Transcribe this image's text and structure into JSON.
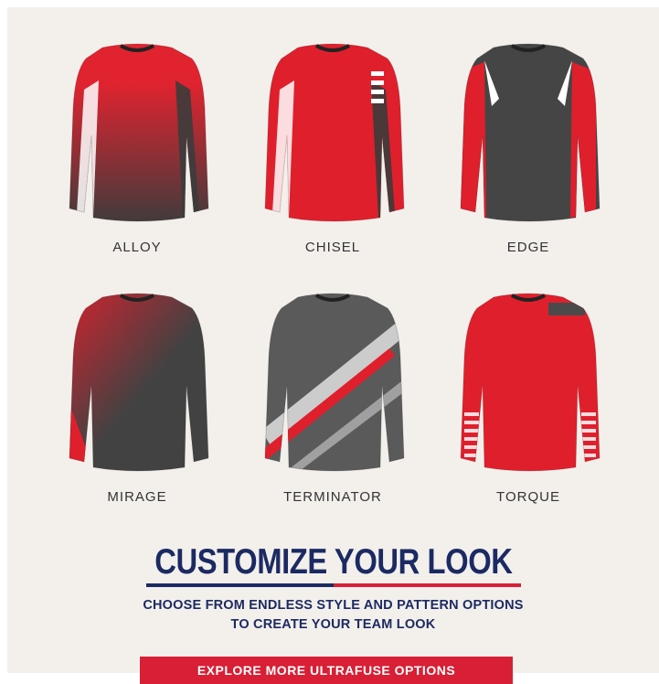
{
  "products": [
    {
      "name": "ALLOY",
      "style": "fade",
      "base": "#e0232f",
      "accent": "#3c3c3c",
      "stripe": "#ffffff"
    },
    {
      "name": "CHISEL",
      "style": "chisel",
      "base": "#e01f2c",
      "accent": "#3b3b3b",
      "stripe": "#ffffff"
    },
    {
      "name": "EDGE",
      "style": "edge",
      "base": "#454545",
      "accent": "#e01f2c",
      "stripe": "#ffffff"
    },
    {
      "name": "MIRAGE",
      "style": "mirage",
      "base": "#424242",
      "accent": "#e01f2c",
      "stripe": "#ffffff"
    },
    {
      "name": "TERMINATOR",
      "style": "terminator",
      "base": "#5a5a5a",
      "accent": "#e01f2c",
      "stripe": "#e8e8e8"
    },
    {
      "name": "TORQUE",
      "style": "torque",
      "base": "#e01f2c",
      "accent": "#4a4a4a",
      "stripe": "#ffffff"
    }
  ],
  "cta": {
    "headline": "CUSTOMIZE YOUR LOOK",
    "subtext": "CHOOSE FROM ENDLESS STYLE AND PATTERN OPTIONS TO CREATE YOUR TEAM LOOK",
    "button_label": "EXPLORE MORE ULTRAFUSE OPTIONS",
    "colors": {
      "navy": "#1c2a63",
      "red": "#d81f35"
    }
  }
}
